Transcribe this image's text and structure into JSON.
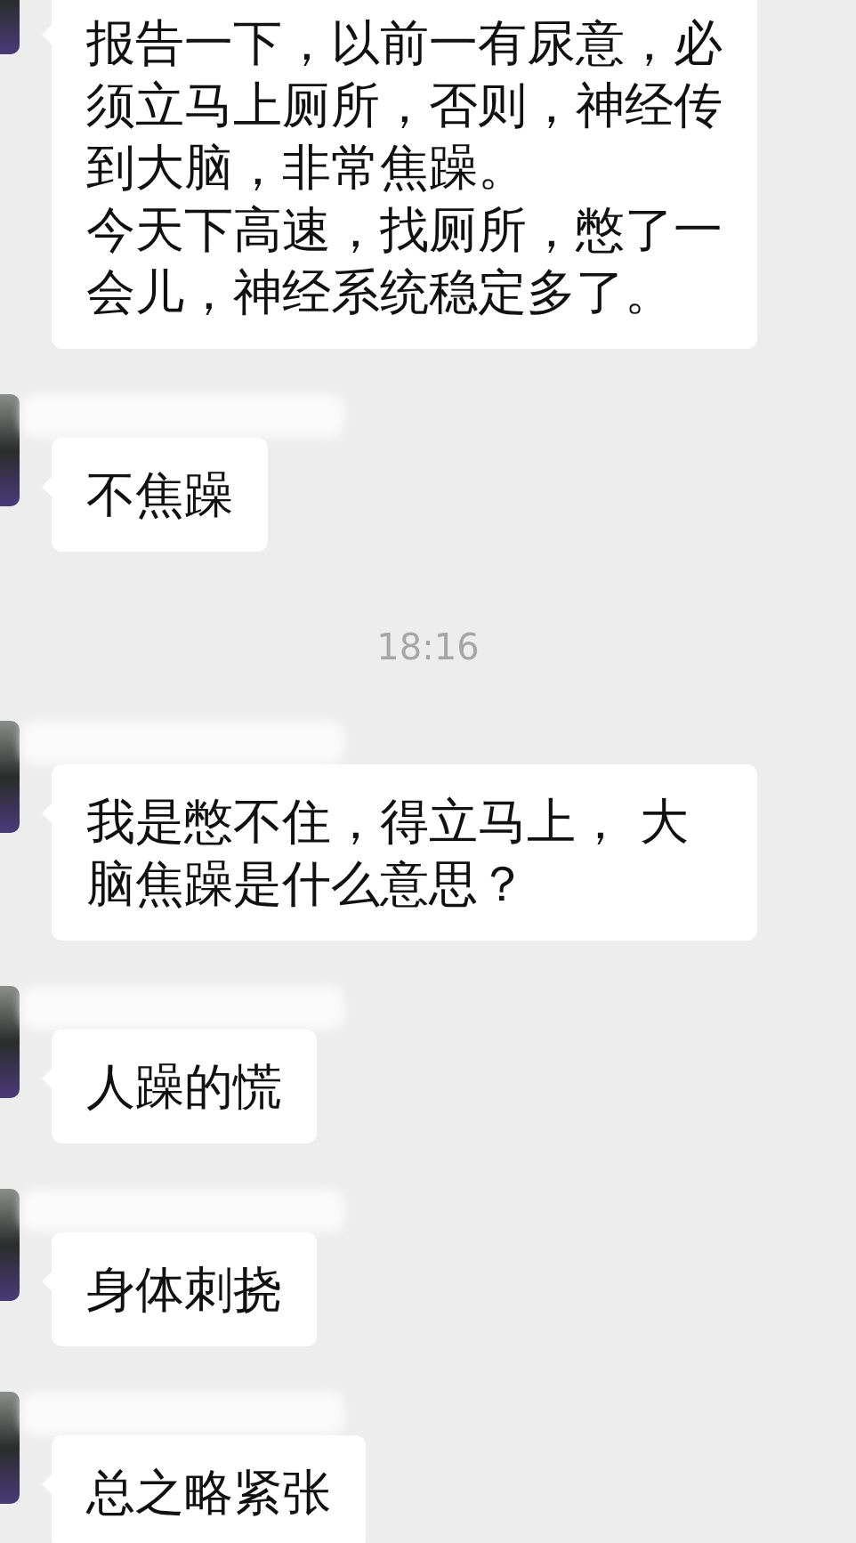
{
  "messages": [
    {
      "kind": "message",
      "paragraphs": [
        "报告一下，以前一有尿意，必须立马上厕所，否则，神经传到大脑，非常焦躁。",
        "今天下高速，找厕所，憋了一会儿，神经系统稳定多了。"
      ]
    },
    {
      "kind": "message",
      "text": "不焦躁"
    },
    {
      "kind": "time",
      "text": "18:16"
    },
    {
      "kind": "message",
      "text": "我是憋不住，得立马上， 大脑焦躁是什么意思？"
    },
    {
      "kind": "message",
      "text": "人躁的慌"
    },
    {
      "kind": "message",
      "text": "身体刺挠"
    },
    {
      "kind": "message",
      "text": "总之略紧张"
    }
  ]
}
